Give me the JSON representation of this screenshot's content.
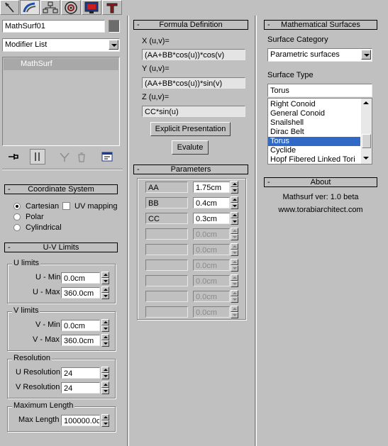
{
  "object_name": "MathSurf01",
  "modifier_list": {
    "label": "Modifier List"
  },
  "stack": {
    "items": [
      "MathSurf"
    ]
  },
  "coordinate_system": {
    "title": "Coordinate System",
    "options": [
      "Cartesian",
      "Polar",
      "Cylindrical"
    ],
    "selected": "Cartesian",
    "uv_mapping": "UV mapping"
  },
  "uv_limits": {
    "title": "U-V Limits",
    "u_limits": {
      "label": "U limits",
      "min_label": "U - Min",
      "min": "0.0cm",
      "max_label": "U - Max",
      "max": "360.0cm"
    },
    "v_limits": {
      "label": "V limits",
      "min_label": "V - Min",
      "min": "0.0cm",
      "max_label": "V - Max",
      "max": "360.0cm"
    },
    "resolution": {
      "label": "Resolution",
      "u_label": "U Resolution",
      "u": "24",
      "v_label": "V Resolution",
      "v": "24"
    },
    "max_length": {
      "label": "Maximum Length",
      "field_label": "Max Length",
      "value": "100000.0c"
    }
  },
  "formula": {
    "title": "Formula Definition",
    "x_label": "X (u,v)=",
    "x": "(AA+BB*cos(u))*cos(v)",
    "y_label": "Y (u,v)=",
    "y": "(AA+BB*cos(u))*sin(v)",
    "z_label": "Z (u,v)=",
    "z": "CC*sin(u)",
    "explicit_button": "Explicit Presentation",
    "evaluate_button": "Evalute"
  },
  "parameters": {
    "title": "Parameters",
    "rows": [
      {
        "name": "AA",
        "value": "1.75cm",
        "enabled": true
      },
      {
        "name": "BB",
        "value": "0.4cm",
        "enabled": true
      },
      {
        "name": "CC",
        "value": "0.3cm",
        "enabled": true
      },
      {
        "name": "",
        "value": "0.0cm",
        "enabled": false
      },
      {
        "name": "",
        "value": "0.0cm",
        "enabled": false
      },
      {
        "name": "",
        "value": "0.0cm",
        "enabled": false
      },
      {
        "name": "",
        "value": "0.0cm",
        "enabled": false
      },
      {
        "name": "",
        "value": "0.0cm",
        "enabled": false
      },
      {
        "name": "",
        "value": "0.0cm",
        "enabled": false
      }
    ]
  },
  "math_surfaces": {
    "title": "Mathematical Surfaces",
    "category_label": "Surface Category",
    "category": "Parametric surfaces",
    "type_label": "Surface Type",
    "type": "Torus",
    "list": [
      "Right Conoid",
      "General Conoid",
      "Snailshell",
      "Dirac Belt",
      "Torus",
      "Cyclide",
      "Hopf Fibered Linked Tori"
    ],
    "selected": "Torus"
  },
  "about": {
    "title": "About",
    "version": "Mathsurf ver: 1.0 beta",
    "website": "www.torabiarchitect.com"
  },
  "toolbar": {
    "icons": [
      "create-tab-icon",
      "modify-tab-icon",
      "hierarchy-tab-icon",
      "motion-tab-icon",
      "display-tab-icon",
      "utilities-tab-icon"
    ]
  },
  "stack_tools": {
    "icons": [
      "pin-stack-icon",
      "show-end-result-icon",
      "make-unique-icon",
      "remove-modifier-icon",
      "configure-modifier-sets-icon"
    ]
  },
  "colors": {
    "panel": "#c0c0c0",
    "selection": "#3169c6",
    "stack_item": "#a8a8a8",
    "color_swatch": "#6c6c6c"
  }
}
